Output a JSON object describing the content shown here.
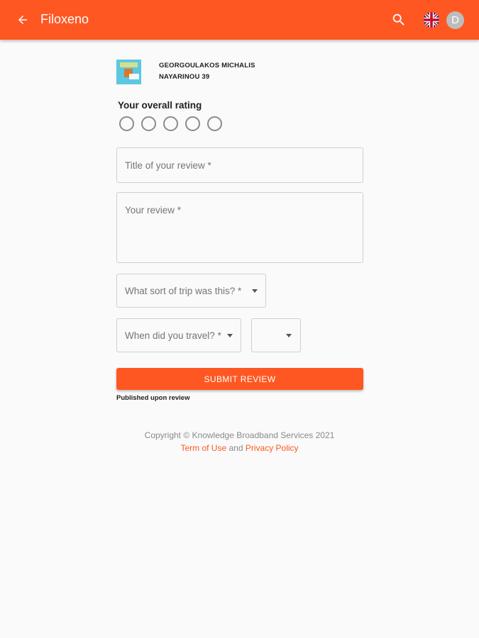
{
  "appbar": {
    "title": "Filoxeno",
    "back_icon": "arrow-back-icon",
    "search_icon": "search-icon",
    "language_flag": "uk-flag-icon",
    "avatar_initial": "D",
    "color": "#ff5722"
  },
  "property": {
    "name": "GEORGOULAKOS MICHALIS",
    "address": "NAYARINOU 39"
  },
  "rating": {
    "label": "Your overall rating",
    "options": 5,
    "selected": 0
  },
  "form": {
    "title_placeholder": "Title of your review *",
    "review_placeholder": "Your review *",
    "trip_type_placeholder": "What sort of trip was this? *",
    "travel_date_placeholder": "When did you travel? *",
    "travel_year_value": ""
  },
  "submit": {
    "label": "SUBMIT REVIEW",
    "note": "Published upon review"
  },
  "footer": {
    "copyright": "Copyright © Knowledge Broadband Services 2021",
    "terms_label": "Term of Use",
    "and_label": "and",
    "privacy_label": "Privacy Policy",
    "link_color": "#ff5722"
  }
}
